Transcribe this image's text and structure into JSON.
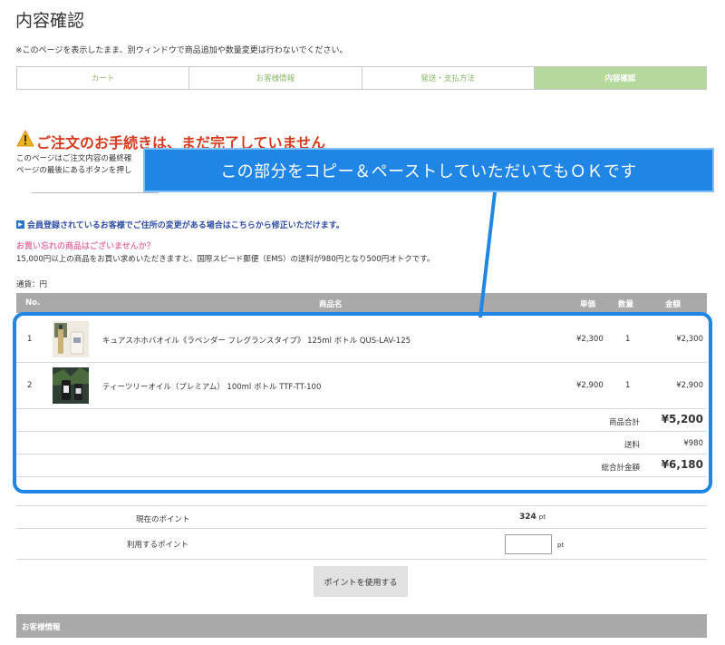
{
  "page": {
    "title": "内容確認",
    "notice": "※このページを表示したまま、別ウィンドウで商品追加や数量変更は行わないでください。"
  },
  "steps": [
    "カート",
    "お客様情報",
    "発送・支払方法",
    "内容確認"
  ],
  "warning": {
    "title": "ご注文のお手続きは、まだ完了していません",
    "line1": "このページはご注文内容の最終確",
    "line2": "ページの最後にあるボタンを押し"
  },
  "callout": "この部分をコピー＆ペーストしていただいてもＯＫです",
  "member_link": "会員登録されているお客様でご住所の変更がある場合はこちらから修正いただけます。",
  "forgot": {
    "title": "お買い忘れの商品はございませんか？",
    "note": "15,000円以上の商品をお買い求めいただきますと、国際スピード郵便（EMS）の送料が980円となり500円オトクです。"
  },
  "currency_label": "通貨：円",
  "table": {
    "headers": {
      "no": "No.",
      "name": "商品名",
      "price": "単価",
      "qty": "数量",
      "subtotal": "金額"
    },
    "items": [
      {
        "no": "1",
        "name": "キュアスホホバオイル《ラベンダー フレグランスタイプ》 125ml ボトル QUS-LAV-125",
        "price": "¥2,300",
        "qty": "1",
        "subtotal": "¥2,300"
      },
      {
        "no": "2",
        "name": "ティーツリーオイル（プレミアム） 100ml ボトル TTF-TT-100",
        "price": "¥2,900",
        "qty": "1",
        "subtotal": "¥2,900"
      }
    ],
    "summary": {
      "goods_label": "商品合計",
      "goods_value": "¥5,200",
      "shipping_label": "送料",
      "shipping_value": "¥980",
      "total_label": "総合計金額",
      "total_value": "¥6,180"
    }
  },
  "points": {
    "current_label": "現在のポイント",
    "current_value": "324",
    "unit": "pt",
    "use_label": "利用するポイント",
    "input_value": "",
    "use_button": "ポイントを使用する"
  },
  "customer_section": "お客様情報",
  "colors": {
    "accent": "#1f86e6",
    "step_active": "#b5d99c",
    "warning": "#d43a1e",
    "table_header": "#a9a9a9"
  }
}
